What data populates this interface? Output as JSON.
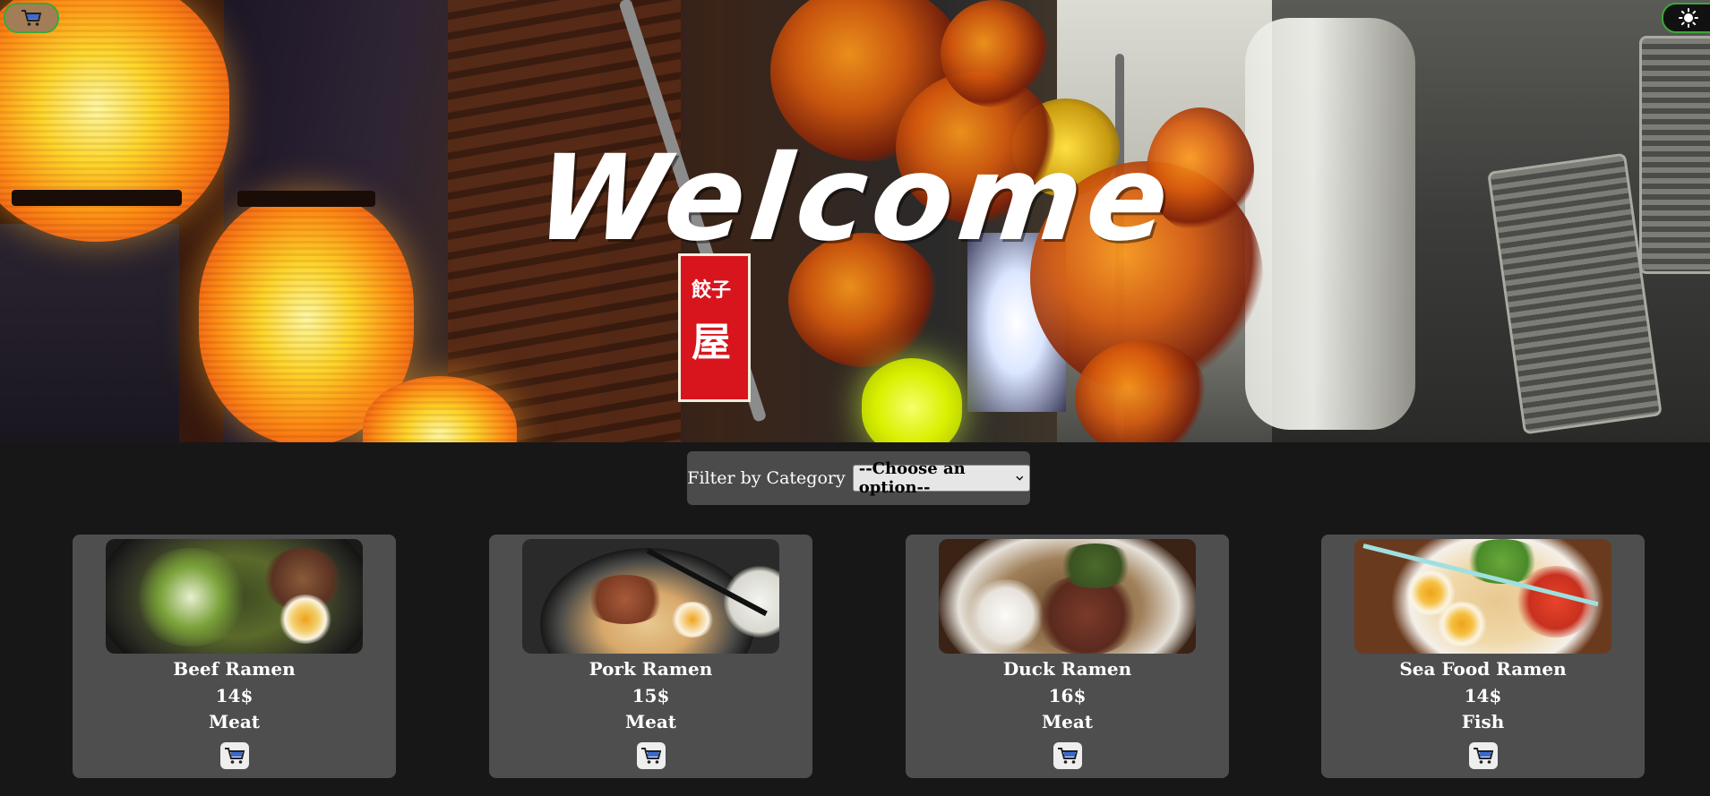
{
  "hero": {
    "title": "Welcome"
  },
  "header": {
    "cart_icon": "cart-icon",
    "theme_icon": "sun-icon"
  },
  "filter": {
    "label": "Filter by Category",
    "selected": "--Choose an option--"
  },
  "products": [
    {
      "name": "Beef Ramen",
      "price": "14$",
      "category": "Meat"
    },
    {
      "name": "Pork Ramen",
      "price": "15$",
      "category": "Meat"
    },
    {
      "name": "Duck Ramen",
      "price": "16$",
      "category": "Meat"
    },
    {
      "name": "Sea Food Ramen",
      "price": "14$",
      "category": "Fish"
    }
  ],
  "colors": {
    "page_bg": "#171717",
    "card_bg": "#4e4e4e",
    "filter_bg": "#4b4b4b",
    "accent_border": "#3aa83a"
  }
}
